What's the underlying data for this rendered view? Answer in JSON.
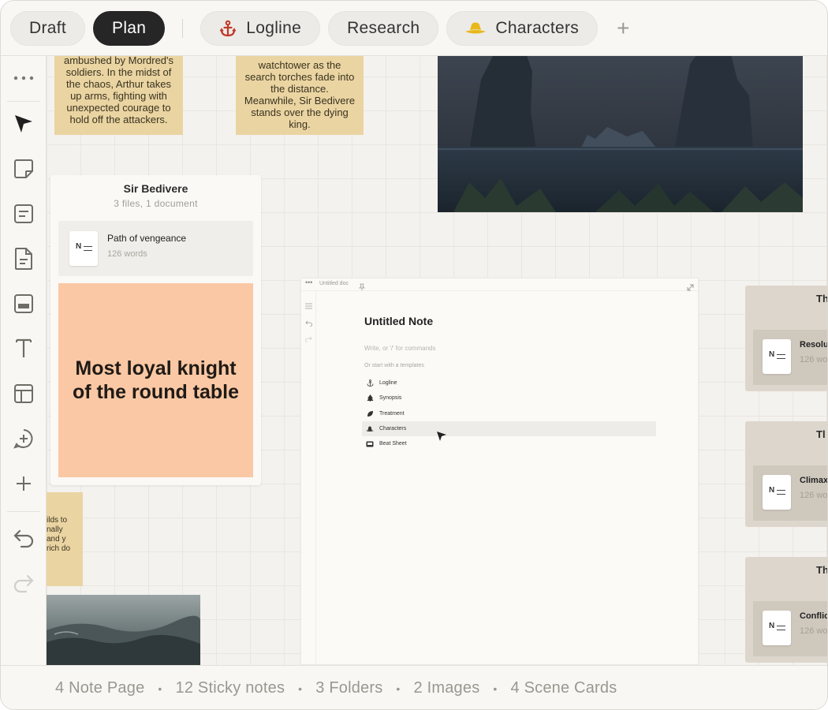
{
  "tabs": {
    "draft": "Draft",
    "plan": "Plan",
    "logline": "Logline",
    "research": "Research",
    "characters": "Characters"
  },
  "stickies": {
    "left_top": "ambushed by Mordred's soldiers. In the midst of the chaos, Arthur takes up arms, fighting with unexpected courage to hold off the attackers.",
    "middle_top": "watchtower as the search torches fade into the distance. Meanwhile, Sir Bedivere stands over the dying king.",
    "left_lower": "ilds to nally and y rich do"
  },
  "folder": {
    "title": "Sir Bedivere",
    "subtitle": "3 files, 1 document",
    "doc_title": "Path of vengeance",
    "doc_words": "126 words",
    "sticky_text": "Most loyal knight of the round table"
  },
  "note": {
    "breadcrumb": "Untitled doc",
    "title": "Untitled Note",
    "placeholder": "Write, or '/' for commands",
    "start_label": "Or start with a templates",
    "templates": [
      "Logline",
      "Synopsis",
      "Treatment",
      "Characters",
      "Beat Sheet"
    ]
  },
  "scenes": [
    {
      "heading": "Th",
      "doc": "Resolu",
      "words": "126 wo"
    },
    {
      "heading": "Tl",
      "doc": "Climax",
      "words": "126 wo"
    },
    {
      "heading": "Th",
      "doc": "Conflic",
      "words": "126 wo"
    }
  ],
  "status": {
    "notes": "4 Note Page",
    "stickies": "12 Sticky notes",
    "folders": "3 Folders",
    "images": "2 Images",
    "scenes": "4 Scene Cards",
    "separator": "•"
  },
  "colors": {
    "sticky_yellow": "#ead4a2",
    "sticky_peach": "#fac8a4",
    "active_tab": "#262626",
    "logline_icon": "#c0392b",
    "characters_icon": "#e8b81a"
  }
}
